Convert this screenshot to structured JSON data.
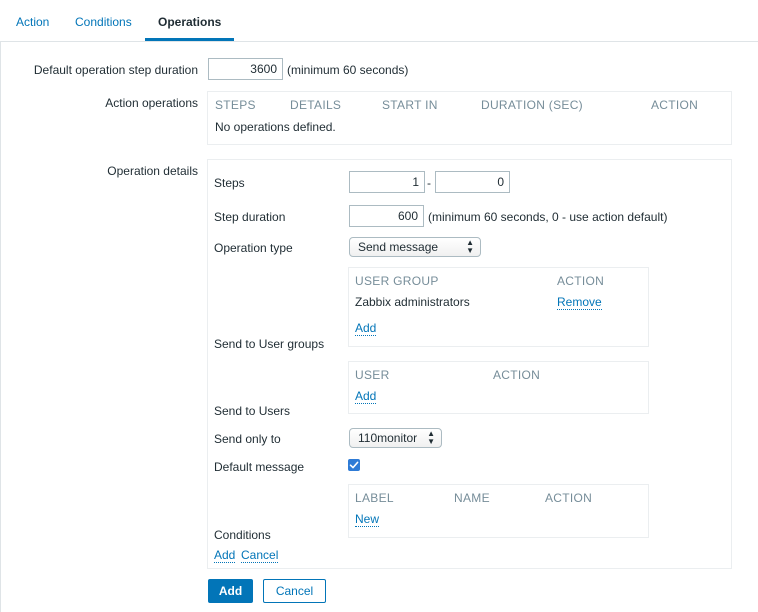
{
  "tabs": [
    "Action",
    "Conditions",
    "Operations"
  ],
  "default_step": {
    "label": "Default operation step duration",
    "value": "3600",
    "hint": "(minimum 60 seconds)"
  },
  "action_operations": {
    "label": "Action operations",
    "headers": [
      "STEPS",
      "DETAILS",
      "START IN",
      "DURATION (SEC)",
      "ACTION"
    ],
    "empty": "No operations defined."
  },
  "operation_details": {
    "label": "Operation details",
    "steps_label": "Steps",
    "steps_from": "1",
    "steps_sep": "-",
    "steps_to": "0",
    "step_duration_label": "Step duration",
    "step_duration_value": "600",
    "step_duration_hint": "(minimum 60 seconds, 0 - use action default)",
    "operation_type_label": "Operation type",
    "operation_type_value": "Send message",
    "user_groups": {
      "label": "Send to User groups",
      "col_group": "USER GROUP",
      "col_action": "ACTION",
      "rows": [
        {
          "name": "Zabbix administrators",
          "action": "Remove"
        }
      ],
      "add": "Add"
    },
    "users": {
      "label": "Send to Users",
      "col_user": "USER",
      "col_action": "ACTION",
      "add": "Add"
    },
    "send_only_to_label": "Send only to",
    "send_only_to_value": "110monitor",
    "default_message_label": "Default message",
    "default_message_checked": true,
    "conditions": {
      "label": "Conditions",
      "col_label": "LABEL",
      "col_name": "NAME",
      "col_action": "ACTION",
      "new": "New"
    },
    "add_link": "Add",
    "cancel_link": "Cancel"
  },
  "buttons": {
    "add": "Add",
    "cancel": "Cancel"
  },
  "colors": {
    "link": "#0275b8",
    "header": "#768d99",
    "border": "#acbbc2",
    "primary": "#0275b8"
  }
}
